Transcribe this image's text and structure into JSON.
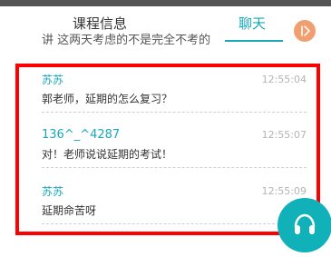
{
  "tabs": [
    {
      "label": "课程信息",
      "active": false
    },
    {
      "label": "聊天",
      "active": true
    }
  ],
  "tab_toggle_icon": "side-arrow-icon",
  "clipped_message": "讲 这两天考虑的不是完全不考的",
  "messages": [
    {
      "name": "苏苏",
      "time": "12:55:04",
      "text": "郭老师，延期的怎么复习？"
    },
    {
      "name": "136^_^4287",
      "time": "12:55:07",
      "text": "对！老师说说延期的考试！"
    },
    {
      "name": "苏苏",
      "time": "12:55:09",
      "text": "延期命苦呀"
    }
  ],
  "support_icon": "headset-icon",
  "colors": {
    "accent": "#1aa8b8",
    "highlight": "#ff0000",
    "toggle": "#f0a070",
    "support": "#11b1ba"
  }
}
